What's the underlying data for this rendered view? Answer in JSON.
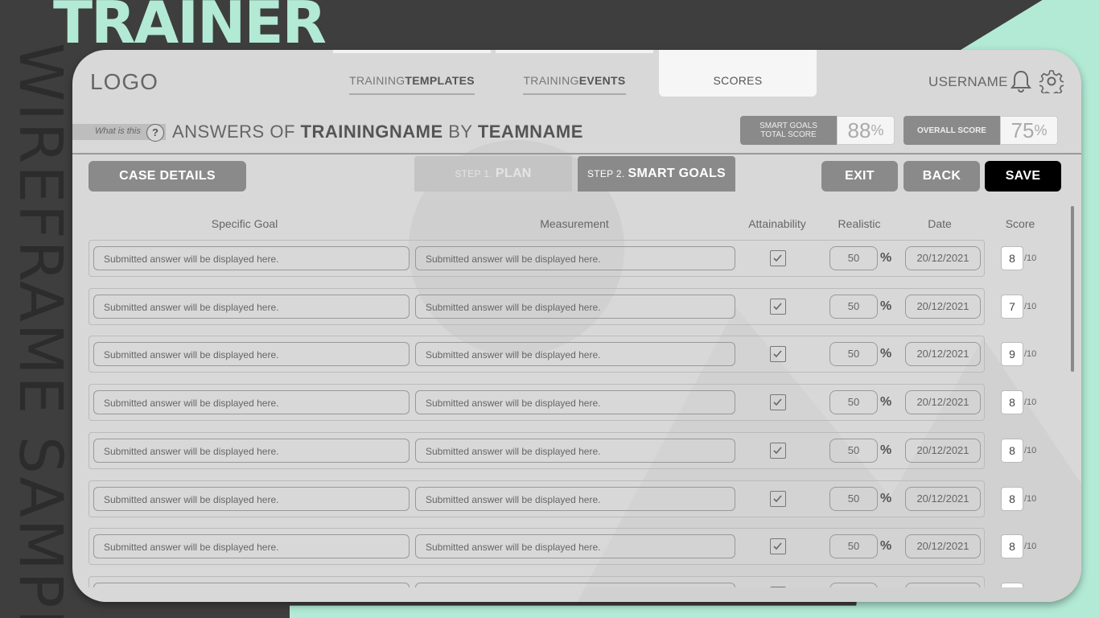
{
  "branding": {
    "app_title": "TRAINER",
    "side_watermark": "WIREFRAME SAMPLE",
    "logo": "LOGO"
  },
  "nav": {
    "tabs": [
      {
        "prefix": "TRAINING ",
        "bold": "TEMPLATES"
      },
      {
        "prefix": "TRAINING ",
        "bold": "EVENTS"
      },
      {
        "prefix": "",
        "bold": "SCORES"
      }
    ],
    "username": "USERNAME"
  },
  "header": {
    "what_is_this": "What is this",
    "help_glyph": "?",
    "answers_prefix": "ANSWERS OF ",
    "training_name": "TRAININGNAME",
    "by": " BY ",
    "team_name": "TEAMNAME",
    "smart_goals_label_1": "SMART GOALS",
    "smart_goals_label_2": "TOTAL SCORE",
    "smart_goals_value": "88",
    "overall_label": "OVERALL SCORE",
    "overall_value": "75",
    "percent": "%"
  },
  "toolbar": {
    "case_details": "CASE DETAILS",
    "step1_prefix": "STEP 1.",
    "step1_label": "PLAN",
    "step2_prefix": "STEP 2.",
    "step2_label": "SMART GOALS",
    "exit": "EXIT",
    "back": "BACK",
    "save": "SAVE"
  },
  "table": {
    "columns": [
      "Specific Goal",
      "Measurement",
      "Attainability",
      "Realistic",
      "Date",
      "Score"
    ],
    "percent_sign": "%",
    "score_max": "/10",
    "rows": [
      {
        "goal": "Submitted answer will be displayed here.",
        "measurement": "Submitted answer will be displayed here.",
        "attainable": true,
        "realistic": "50",
        "date": "20/12/2021",
        "score": "8"
      },
      {
        "goal": "Submitted answer will be displayed here.",
        "measurement": "Submitted answer will be displayed here.",
        "attainable": true,
        "realistic": "50",
        "date": "20/12/2021",
        "score": "7"
      },
      {
        "goal": "Submitted answer will be displayed here.",
        "measurement": "Submitted answer will be displayed here.",
        "attainable": true,
        "realistic": "50",
        "date": "20/12/2021",
        "score": "9"
      },
      {
        "goal": "Submitted answer will be displayed here.",
        "measurement": "Submitted answer will be displayed here.",
        "attainable": true,
        "realistic": "50",
        "date": "20/12/2021",
        "score": "8"
      },
      {
        "goal": "Submitted answer will be displayed here.",
        "measurement": "Submitted answer will be displayed here.",
        "attainable": true,
        "realistic": "50",
        "date": "20/12/2021",
        "score": "8"
      },
      {
        "goal": "Submitted answer will be displayed here.",
        "measurement": "Submitted answer will be displayed here.",
        "attainable": true,
        "realistic": "50",
        "date": "20/12/2021",
        "score": "8"
      },
      {
        "goal": "Submitted answer will be displayed here.",
        "measurement": "Submitted answer will be displayed here.",
        "attainable": true,
        "realistic": "50",
        "date": "20/12/2021",
        "score": "8"
      },
      {
        "goal": "",
        "measurement": "",
        "attainable": true,
        "realistic": "",
        "date": "",
        "score": ""
      }
    ]
  }
}
